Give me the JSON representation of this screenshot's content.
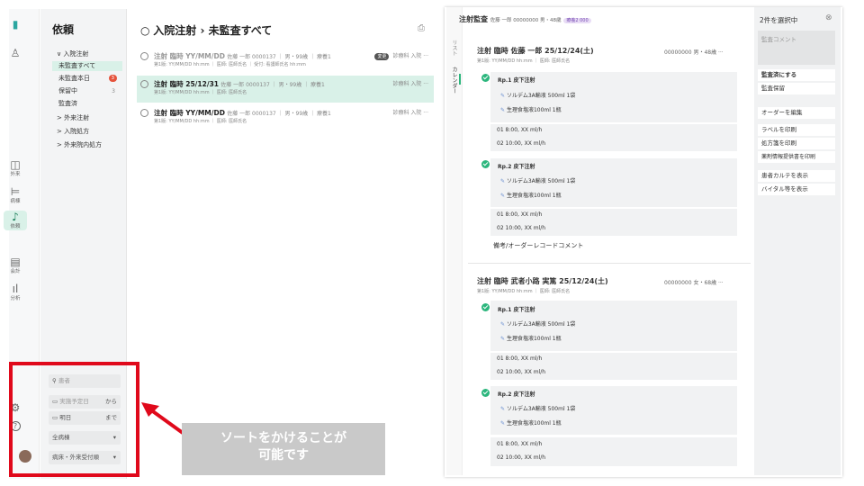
{
  "left_app": {
    "rail": [
      {
        "label": "",
        "icon": "logo-icon"
      },
      {
        "label": "",
        "icon": "user-icon"
      },
      {
        "label": "外来",
        "icon": "book-icon"
      },
      {
        "label": "病棟",
        "icon": "bed-icon"
      },
      {
        "label": "依頼",
        "icon": "bell-icon"
      },
      {
        "label": "会計",
        "icon": "receipt-icon"
      },
      {
        "label": "分析",
        "icon": "bar-chart-icon"
      }
    ],
    "rail_bottom": {
      "settings": "⚙",
      "help": "?"
    },
    "nav": {
      "title": "依頼",
      "items": [
        {
          "label": "∨ 入院注射"
        },
        {
          "label": "未監査すべて"
        },
        {
          "label": "未監査本日",
          "badge": "3"
        },
        {
          "label": "保留中",
          "count": "3"
        },
        {
          "label": "監査済"
        },
        {
          "label": "> 外来注射"
        },
        {
          "label": "> 入院処方"
        },
        {
          "label": "> 外来院内処方"
        }
      ]
    },
    "filters": {
      "search_placeholder": "患者",
      "date_label": "実施予定日",
      "date_from": "から",
      "date_day": "明日",
      "date_to": "まで",
      "ward": "全病棟",
      "ward_type": "病床・外来受付順"
    },
    "header": {
      "title": "入院注射 › 未監査すべて"
    },
    "rows": [
      {
        "line1_bold": "注射 臨時 YY/MM/DD",
        "line1_meta": "佐藤 一郎 0000137 ｜ 男・99歳 ｜ 療養1",
        "line2": "第1版: YY/MM/DD hh:mm ｜ 医師: 医師氏名 ｜ 受付: 看護師氏名 hh:mm",
        "tag": "変更",
        "dept": "診療科 入院 ···"
      },
      {
        "line1_bold": "注射 臨時 25/12/31",
        "line1_meta": "佐藤 一郎 0000137 ｜ 男・99歳 ｜ 療養1",
        "line2": "第1版: YY/MM/DD hh:mm ｜ 医師: 医師氏名",
        "tag": "",
        "dept": "診療科 入院 ···"
      },
      {
        "line1_bold": "注射 臨時 YY/MM/DD",
        "line1_meta": "佐藤 一郎 0000137 ｜ 男・99歳 ｜ 療養1",
        "line2": "第1版: YY/MM/DD hh:mm ｜ 医師: 医師氏名",
        "tag": "",
        "dept": "診療科 入院 ···"
      }
    ],
    "callout": {
      "line1": "ソートをかけることが",
      "line2": "可能です"
    }
  },
  "right_app": {
    "header": {
      "title": "注射監査",
      "patient": "佐藤 一郎 00000000 男・48歳",
      "badge": "療養2 000"
    },
    "vtabs": {
      "tab1": "リスト",
      "tab2": "カレンダー"
    },
    "orders": [
      {
        "title": "注射 臨時 佐藤 一郎 25/12/24(土)",
        "meta": "00000000 男・48歳 ···",
        "sub": "第1版: YY/MM/DD hh:mm ｜ 医師: 医師氏名",
        "rps": [
          {
            "name": "Rp.1 皮下注射",
            "drugs": [
              "ソルデム3A輸液 500ml 1袋",
              "生理食塩液100ml 1瓶"
            ],
            "times": [
              "01 8:00, XX ml/h",
              "02 10:00, XX ml/h"
            ]
          },
          {
            "name": "Rp.2 皮下注射",
            "drugs": [
              "ソルデム3A輸液 500ml 1袋",
              "生理食塩液100ml 1瓶"
            ],
            "times": [
              "01 8:00, XX ml/h",
              "02 10:00, XX ml/h"
            ]
          }
        ],
        "note": "備考/オーダーレコードコメント"
      },
      {
        "title": "注射 臨時 武者小路 実篤 25/12/24(土)",
        "meta": "00000000 女・68歳 ···",
        "sub": "第1版: YY/MM/DD hh:mm ｜ 医師: 医師氏名",
        "rps": [
          {
            "name": "Rp.1 皮下注射",
            "drugs": [
              "ソルデム3A輸液 500ml 1袋",
              "生理食塩液100ml 1瓶"
            ],
            "times": [
              "01 8:00, XX ml/h",
              "02 10:00, XX ml/h"
            ]
          },
          {
            "name": "Rp.2 皮下注射",
            "drugs": [
              "ソルデム3A輸液 500ml 1袋",
              "生理食塩液100ml 1瓶"
            ],
            "times": [
              "01 8:00, XX ml/h",
              "02 10:00, XX ml/h"
            ]
          }
        ]
      }
    ],
    "actions": {
      "title": "2件を選択中",
      "comment_placeholder": "監査コメント",
      "buttons": [
        "監査済にする",
        "監査保留",
        "オーダーを編集",
        "ラベルを印刷",
        "処方箋を印刷",
        "薬剤情報提供書を印刷",
        "患者カルテを表示",
        "バイタル等を表示"
      ]
    },
    "colors": {
      "accent": "#2cb67d",
      "selected_row": "#d9f1e8",
      "annotation_red": "#e0091b"
    }
  }
}
